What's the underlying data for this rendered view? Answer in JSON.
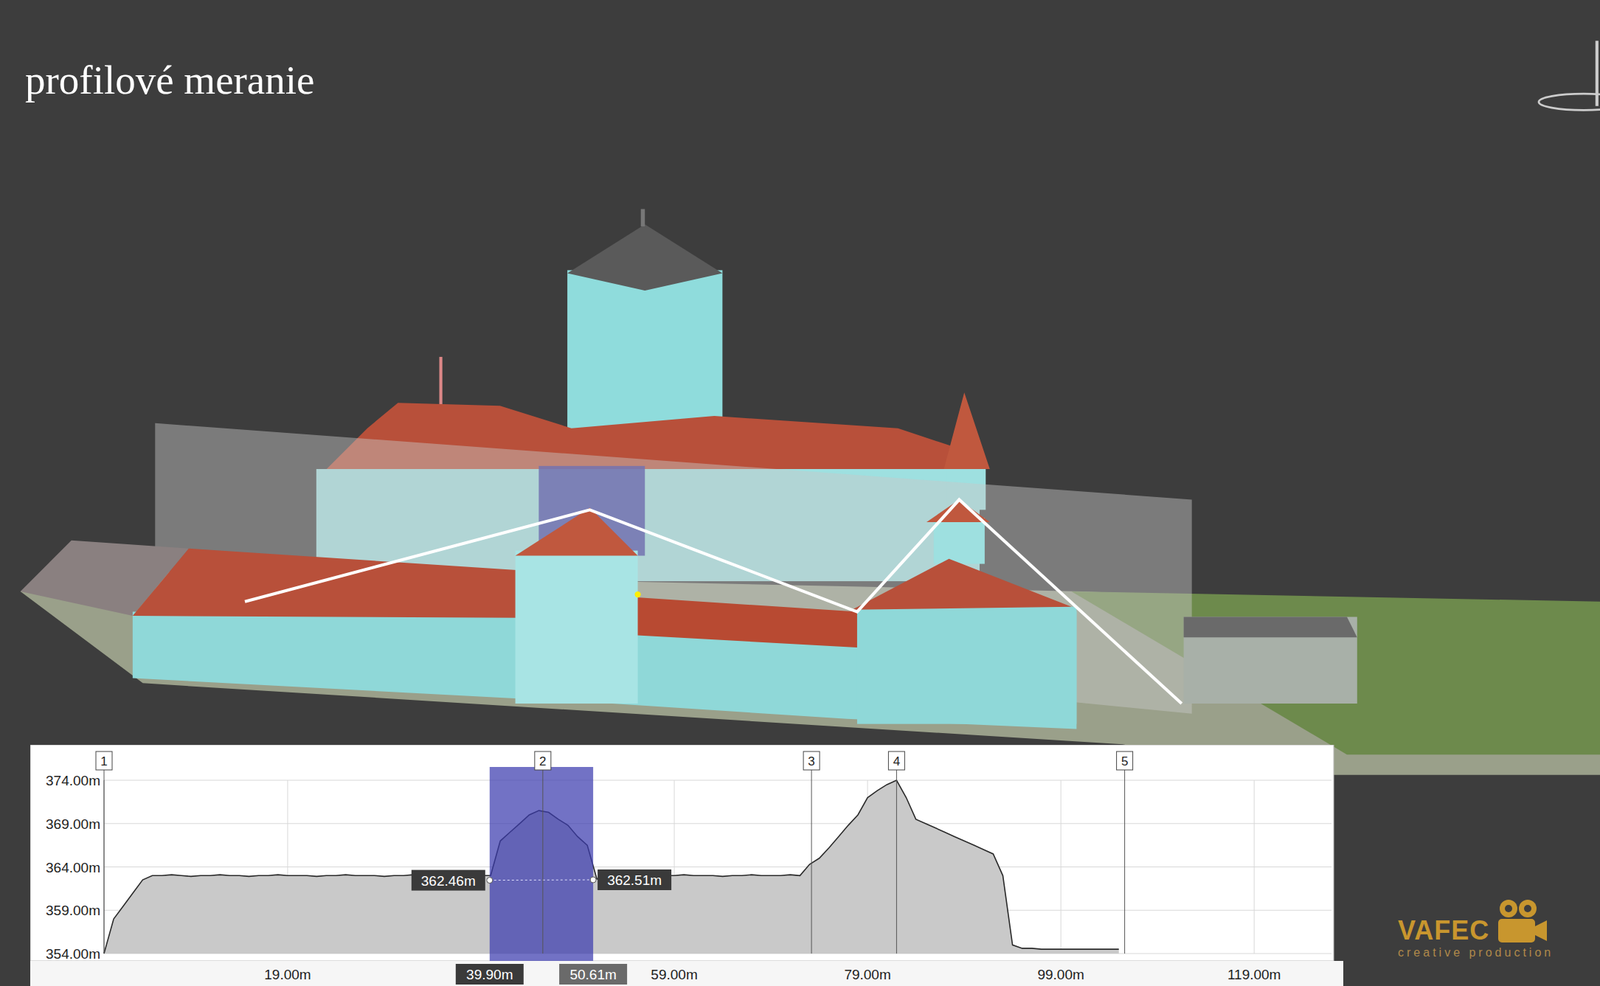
{
  "title": "profilové meranie",
  "profile_chart": {
    "y_ticks": [
      {
        "label": "374.00m",
        "at_m": 374
      },
      {
        "label": "369.00m",
        "at_m": 369
      },
      {
        "label": "364.00m",
        "at_m": 364
      },
      {
        "label": "359.00m",
        "at_m": 359
      },
      {
        "label": "354.00m",
        "at_m": 354
      }
    ],
    "x_ticks": [
      {
        "label": "19.00m",
        "at_m": 19
      },
      {
        "label": "59.00m",
        "at_m": 59
      },
      {
        "label": "79.00m",
        "at_m": 79
      },
      {
        "label": "99.00m",
        "at_m": 99
      },
      {
        "label": "119.00m",
        "at_m": 119
      }
    ],
    "markers": [
      {
        "label": "1",
        "at_m": 0
      },
      {
        "label": "2",
        "at_m": 45.4
      },
      {
        "label": "3",
        "at_m": 73.2
      },
      {
        "label": "4",
        "at_m": 82.0
      },
      {
        "label": "5",
        "at_m": 105.6
      }
    ],
    "selection": {
      "selected": true,
      "from": "39.90m",
      "to": "50.61m",
      "from_m": 39.9,
      "to_m": 50.61,
      "left_height": "362.46m",
      "right_height": "362.51m",
      "left_height_m": 362.46,
      "right_height_m": 362.51
    },
    "series": {
      "x_start_m": 0,
      "x_step_m": 1,
      "values": [
        354,
        358,
        359.5,
        361,
        362.5,
        363,
        363,
        363.1,
        363,
        362.9,
        363,
        363,
        363.1,
        363,
        363,
        362.9,
        363,
        363,
        363.1,
        363,
        363,
        363,
        362.9,
        363,
        363,
        363.1,
        363,
        363,
        363,
        362.9,
        363,
        363,
        363.1,
        363,
        363,
        363,
        362.9,
        363,
        363,
        363,
        363,
        367,
        368,
        369,
        370,
        370.5,
        370.3,
        369.5,
        368.8,
        367.5,
        366.5,
        362.6,
        363,
        363,
        363.1,
        363,
        363,
        362.9,
        363,
        363,
        363.1,
        363,
        363,
        363,
        362.9,
        363,
        363,
        363.1,
        363,
        363,
        363,
        363.1,
        363,
        364.3,
        365,
        366.2,
        367.5,
        368.8,
        370,
        372,
        372.8,
        373.5,
        374,
        372,
        369.5,
        369,
        368.5,
        368,
        367.5,
        367,
        366.5,
        366,
        365.5,
        363,
        355,
        354.6,
        354.6,
        354.5,
        354.5,
        354.5,
        354.5,
        354.5,
        354.5,
        354.5,
        354.5,
        354.5
      ]
    }
  },
  "logo": {
    "name": "VAFEC",
    "tagline": "creative production"
  }
}
